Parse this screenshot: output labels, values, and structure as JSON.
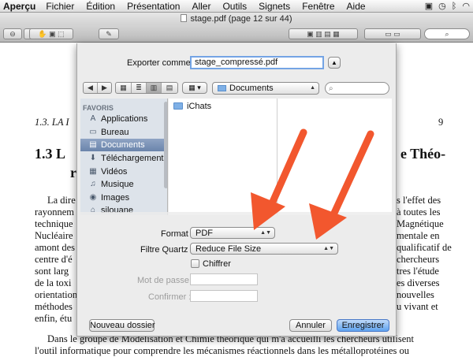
{
  "menubar": {
    "items": [
      "Aperçu",
      "Fichier",
      "Édition",
      "Présentation",
      "Aller",
      "Outils",
      "Signets",
      "Fenêtre",
      "Aide"
    ],
    "status_icons": [
      "ai-icon",
      "time-machine-icon",
      "bluetooth-icon",
      "wifi-icon"
    ]
  },
  "window": {
    "title": "stage.pdf (page 12 sur 44)"
  },
  "document": {
    "lines": [
      "1.3.  LA I",
      "9",
      "1.3   L",
      "e Théo-",
      "r",
      "La dire",
      "s l'effet des",
      "rayonnem",
      "à toutes les",
      "technique",
      "Magnétique",
      "Nucléaire",
      "mentale en",
      "amont des",
      "qualificatif de",
      "centre d'é",
      "chercheurs",
      "sont larg",
      "tres l'étude",
      "de la toxi",
      "es diverses",
      "orientation",
      "nouvelles",
      "méthodes",
      "u vivant et",
      "enfin, étu",
      "Dans le groupe de Modélisation et Chimie théorique qui m'a accueilli les chercheurs utilisent",
      "l'outil informatique pour comprendre les mécanismes réactionnels dans les métalloprotéines ou"
    ]
  },
  "dialog": {
    "export_label": "Exporter comme :",
    "filename": "stage_compressé.pdf",
    "nav_back": "◀",
    "nav_forward": "▶",
    "view_buttons": [
      "▦",
      "≣",
      "▥",
      "▤"
    ],
    "arrange_button": "▦ ▾",
    "location": "Documents",
    "search_placeholder": "",
    "sidebar": {
      "header": "FAVORIS",
      "items": [
        {
          "label": "Applications",
          "icon": "applications-icon",
          "glyph": "A"
        },
        {
          "label": "Bureau",
          "icon": "desktop-icon",
          "glyph": "▭"
        },
        {
          "label": "Documents",
          "icon": "documents-icon",
          "glyph": "▤",
          "selected": true
        },
        {
          "label": "Téléchargements",
          "icon": "downloads-icon",
          "glyph": "⬇"
        },
        {
          "label": "Vidéos",
          "icon": "movies-icon",
          "glyph": "▦"
        },
        {
          "label": "Musique",
          "icon": "music-icon",
          "glyph": "♫"
        },
        {
          "label": "Images",
          "icon": "pictures-icon",
          "glyph": "◉"
        },
        {
          "label": "silouane",
          "icon": "home-icon",
          "glyph": "⌂"
        }
      ]
    },
    "files": [
      "iChats"
    ],
    "format_label": "Format :",
    "format_value": "PDF",
    "quartz_label": "Filtre Quartz :",
    "quartz_value": "Reduce File Size",
    "encrypt_label": "Chiffrer",
    "password_label": "Mot de passe :",
    "confirm_label": "Confirmer :",
    "new_folder": "Nouveau dossier",
    "cancel": "Annuler",
    "save": "Enregistrer"
  },
  "colors": {
    "annotation_arrow": "#f2572e",
    "selection": "#7a91b6",
    "primary_button": "#5ea2ef"
  }
}
